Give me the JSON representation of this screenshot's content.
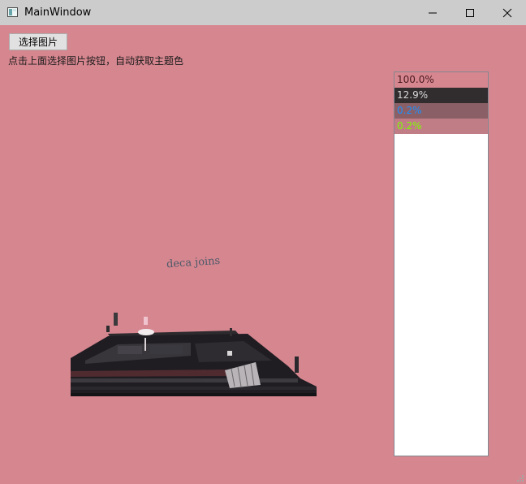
{
  "window": {
    "title": "MainWindow",
    "icon": "app-window-icon",
    "controls": [
      "minimize-icon",
      "maximize-icon",
      "close-icon"
    ]
  },
  "toolbar": {
    "select_image_label": "选择图片"
  },
  "hint_text": "点击上面选择图片按钮，自动获取主题色",
  "image_text": "deca joins",
  "theme_colors": [
    {
      "label": "100.0%",
      "background": "#d6868f",
      "text_color": "#4a1a1f"
    },
    {
      "label": "12.9%",
      "background": "#312d2f",
      "text_color": "#d8d8d8"
    },
    {
      "label": "0.2%",
      "background": "#8a5f65",
      "text_color": "#1e90ff"
    },
    {
      "label": "0.2%",
      "background": "#c17d86",
      "text_color": "#7cfc00"
    }
  ],
  "colors": {
    "window_background": "#d6868f",
    "titlebar": "#cccccc"
  }
}
